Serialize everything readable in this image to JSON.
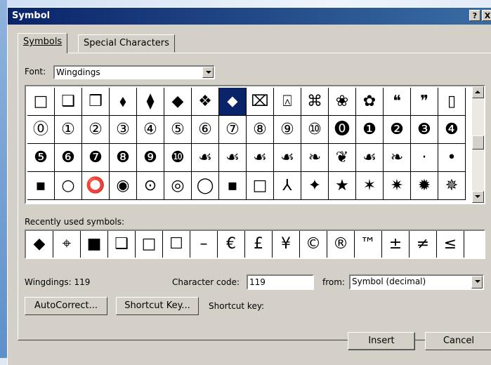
{
  "dialog": {
    "title": "Symbol",
    "help_btn": "?",
    "close_btn": "X"
  },
  "tabs": [
    {
      "label": "Symbols",
      "active": true
    },
    {
      "label": "Special Characters",
      "active": false
    }
  ],
  "font": {
    "label": "Font:",
    "value": "Wingdings"
  },
  "symbols": {
    "rows": [
      [
        "□",
        "❑",
        "❒",
        "⬧",
        "⧫",
        "◆",
        "❖",
        "⬥",
        "⌧",
        "⍓",
        "⌘",
        "❀",
        "✿",
        "❝",
        "❞",
        "▯"
      ],
      [
        "⓪",
        "①",
        "②",
        "③",
        "④",
        "⑤",
        "⑥",
        "⑦",
        "⑧",
        "⑨",
        "⑩",
        "⓿",
        "❶",
        "❷",
        "❸",
        "❹"
      ],
      [
        "❺",
        "❻",
        "❼",
        "❽",
        "❾",
        "❿",
        "☙",
        "☙",
        "☙",
        "☙",
        "❧",
        "❦",
        "☙",
        "❧",
        "·",
        "•"
      ],
      [
        "▪",
        "○",
        "⭕",
        "◉",
        "⊙",
        "◎",
        "◯",
        "▪",
        "□",
        "⅄",
        "✦",
        "★",
        "✶",
        "✷",
        "✹",
        "✵"
      ]
    ],
    "selected": {
      "row": 0,
      "col": 7
    }
  },
  "recent": {
    "label": "Recently used symbols:",
    "items": [
      "◆",
      "⌖",
      "■",
      "❑",
      "□",
      "☐",
      "–",
      "€",
      "£",
      "¥",
      "©",
      "®",
      "™",
      "±",
      "≠",
      "≤"
    ]
  },
  "status": {
    "font_info": "Wingdings: 119"
  },
  "char_code": {
    "label": "Character code:",
    "value": "119"
  },
  "from": {
    "label": "from:",
    "value": "Symbol (decimal)"
  },
  "buttons": {
    "autocorrect": "AutoCorrect...",
    "shortcut_key": "Shortcut Key...",
    "shortcut_label": "Shortcut key:",
    "insert": "Insert",
    "cancel": "Cancel"
  }
}
